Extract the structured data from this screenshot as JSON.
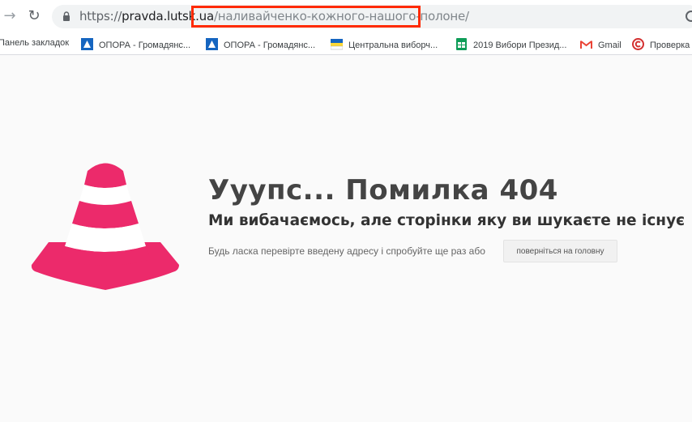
{
  "browser": {
    "url_scheme": "https://",
    "url_host": "pravda.lutsk.ua",
    "url_path": "/наливайченко-кожного-нашого-полоне/"
  },
  "bookmarks": [
    {
      "label": "Панель закладок",
      "icon": "folder-icon"
    },
    {
      "label": "ОПОРА - Громадянс...",
      "icon": "opora-logo-icon",
      "color": "#1565c0"
    },
    {
      "label": "ОПОРА - Громадянс...",
      "icon": "opora-logo-icon",
      "color": "#1565c0"
    },
    {
      "label": "Центральна виборч...",
      "icon": "cvk-flag-icon"
    },
    {
      "label": "2019 Вибори Презид...",
      "icon": "sheets-icon",
      "color": "#0f9d58"
    },
    {
      "label": "Gmail",
      "icon": "gmail-icon",
      "color": "#ea4335"
    },
    {
      "label": "Проверка",
      "icon": "copyright-icon",
      "color": "#d32f2f"
    }
  ],
  "error": {
    "title": "Ууупс... Помилка 404",
    "subtitle": "Ми вибачаємось, але сторінки яку ви шукаєте не існує",
    "note": "Будь ласка перевірте введену адресу і спробуйте ще раз або",
    "home_button": "поверніться на головну"
  },
  "colors": {
    "cone": "#ec2a6b",
    "highlight_box": "#ff2a00"
  }
}
